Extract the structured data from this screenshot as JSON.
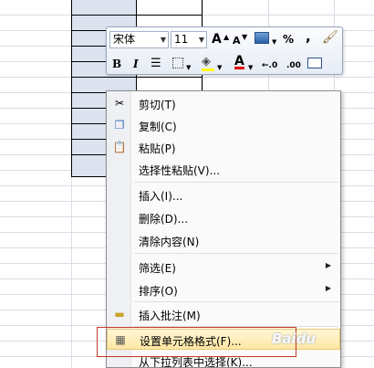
{
  "mini_toolbar": {
    "font_name": "宋体",
    "font_size": "11",
    "grow_font": "A",
    "shrink_font": "A",
    "percent": "%",
    "comma": ",",
    "bold": "B",
    "italic": "I",
    "font_color_letter": "A",
    "decimal_increase": "←.0",
    "decimal_decrease": ".00"
  },
  "context_menu": {
    "items": [
      {
        "label": "剪切(T)",
        "icon": "scissors-icon"
      },
      {
        "label": "复制(C)",
        "icon": "copy-icon"
      },
      {
        "label": "粘贴(P)",
        "icon": "paste-icon"
      },
      {
        "label": "选择性粘贴(V)..."
      },
      {
        "label": "插入(I)..."
      },
      {
        "label": "删除(D)..."
      },
      {
        "label": "清除内容(N)"
      },
      {
        "label": "筛选(E)",
        "submenu": true
      },
      {
        "label": "排序(O)",
        "submenu": true
      },
      {
        "label": "插入批注(M)",
        "icon": "comment-icon"
      },
      {
        "label": "设置单元格格式(F)...",
        "icon": "format-cells-icon",
        "highlighted": true
      },
      {
        "label": "从下拉列表中选择(K)..."
      }
    ]
  },
  "watermark": "Baidu"
}
